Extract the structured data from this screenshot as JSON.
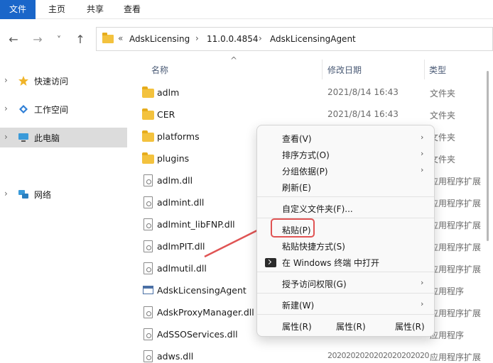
{
  "ribbon": {
    "tabs": [
      "文件",
      "主页",
      "共享",
      "查看"
    ]
  },
  "nav": {
    "back": "←",
    "forward": "→",
    "recent": "˅",
    "up": "↑"
  },
  "address": {
    "overflow": "«",
    "crumbs": [
      "AdskLicensing",
      "11.0.0.4854",
      "AdskLicensingAgent"
    ],
    "separator": "›"
  },
  "sidebar": {
    "items": [
      {
        "label": "快速访问",
        "icon": "star-icon"
      },
      {
        "label": "工作空间",
        "icon": "workspace-icon"
      },
      {
        "label": "此电脑",
        "icon": "computer-icon"
      },
      {
        "label": "网络",
        "icon": "network-icon"
      }
    ]
  },
  "columns": {
    "name": "名称",
    "modified": "修改日期",
    "type": "类型"
  },
  "files": [
    {
      "name": "adlm",
      "icon": "folder-icon",
      "date": "2021/8/14 16:43",
      "type": "文件夹"
    },
    {
      "name": "CER",
      "icon": "folder-icon",
      "date": "2021/8/14 16:43",
      "type": "文件夹"
    },
    {
      "name": "platforms",
      "icon": "folder-icon",
      "date": "",
      "type": "文件夹"
    },
    {
      "name": "plugins",
      "icon": "folder-icon",
      "date": "",
      "type": "文件夹"
    },
    {
      "name": "adlm.dll",
      "icon": "dll-file-icon",
      "date": "",
      "type": "应用程序扩展"
    },
    {
      "name": "adlmint.dll",
      "icon": "dll-file-icon",
      "date": "",
      "type": "应用程序扩展"
    },
    {
      "name": "adlmint_libFNP.dll",
      "icon": "dll-file-icon",
      "date": "",
      "type": "应用程序扩展"
    },
    {
      "name": "adlmPIT.dll",
      "icon": "dll-file-icon",
      "date": "",
      "type": "应用程序扩展"
    },
    {
      "name": "adlmutil.dll",
      "icon": "dll-file-icon",
      "date": "",
      "type": "应用程序扩展"
    },
    {
      "name": "AdskLicensingAgent",
      "icon": "exe-app-icon",
      "date": "",
      "type": "应用程序"
    },
    {
      "name": "AdskProxyManager.dll",
      "icon": "dll-file-icon",
      "date": "",
      "type": "应用程序扩展"
    },
    {
      "name": "AdSSOServices.dll",
      "icon": "dll-file-icon",
      "date": "",
      "type": "应用程序"
    },
    {
      "name": "adws.dll",
      "icon": "dll-file-icon",
      "date": "2020202020202020202020",
      "type": "应用程序扩展"
    }
  ],
  "context_menu": {
    "view": "查看(V)",
    "sort": "排序方式(O)",
    "group": "分组依据(P)",
    "refresh": "刷新(E)",
    "customize": "自定义文件夹(F)...",
    "paste": "粘贴(P)",
    "paste_shortcut": "粘贴快捷方式(S)",
    "open_terminal": "在 Windows 终端 中打开",
    "grant_access": "授予访问权限(G)",
    "new": "新建(W)",
    "properties": "属性(R)"
  },
  "colors": {
    "accent": "#1a66c9",
    "annotation": "#e05454",
    "folder": "#f3c23e"
  }
}
